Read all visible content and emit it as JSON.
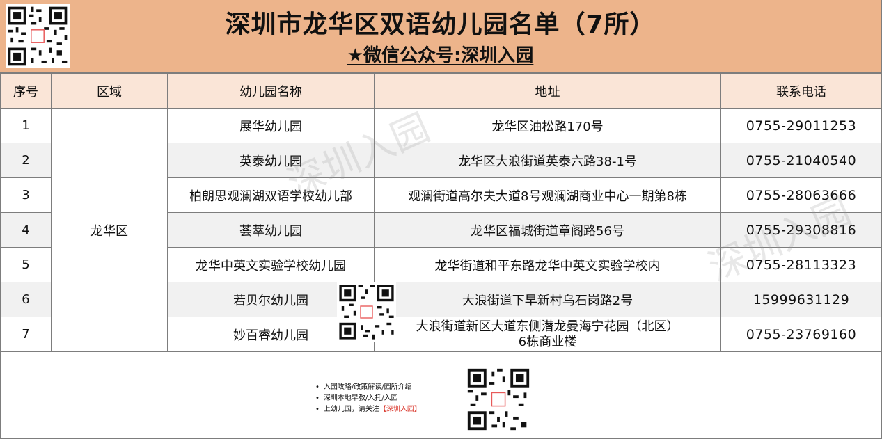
{
  "header": {
    "title": "深圳市龙华区双语幼儿园名单（7所）",
    "subtitle": "★微信公众号:深圳入园"
  },
  "table": {
    "columns": [
      "序号",
      "区域",
      "幼儿园名称",
      "地址",
      "联系电话"
    ],
    "district": "龙华区",
    "rows": [
      {
        "no": "1",
        "name": "展华幼儿园",
        "address": "龙华区油松路170号",
        "phone": "0755-29011253"
      },
      {
        "no": "2",
        "name": "英泰幼儿园",
        "address": "龙华区大浪街道英泰六路38-1号",
        "phone": "0755-21040540"
      },
      {
        "no": "3",
        "name": "柏朗思观澜湖双语学校幼儿部",
        "address": "观澜街道高尔夫大道8号观澜湖商业中心一期第8栋",
        "phone": "0755-28063666"
      },
      {
        "no": "4",
        "name": "荟萃幼儿园",
        "address": "龙华区福城街道章阁路56号",
        "phone": "0755-29308816"
      },
      {
        "no": "5",
        "name": "龙华中英文实验学校幼儿园",
        "address": "龙华街道和平东路龙华中英文实验学校内",
        "phone": "0755-28113323"
      },
      {
        "no": "6",
        "name": "若贝尔幼儿园",
        "address": "大浪街道下早新村乌石岗路2号",
        "phone": "15999631129"
      },
      {
        "no": "7",
        "name": "妙百睿幼儿园",
        "address_line1": "大浪街道新区大道东侧潜龙曼海宁花园（北区）",
        "address_line2": "6栋商业楼",
        "phone": "0755-23769160"
      }
    ]
  },
  "footer": {
    "bullets": [
      "入园攻略/政策解读/园所介绍",
      "深圳本地早教/入托/入园"
    ],
    "bullet3_prefix": "上幼儿园，请关注",
    "bullet3_highlight": "【深圳入园】"
  },
  "watermarks": {
    "text_1": "深圳入园",
    "text_2": "深圳入园"
  },
  "icons": {
    "qr_top": "qr-code-icon",
    "qr_middle": "qr-code-icon",
    "qr_footer": "qr-code-icon"
  }
}
